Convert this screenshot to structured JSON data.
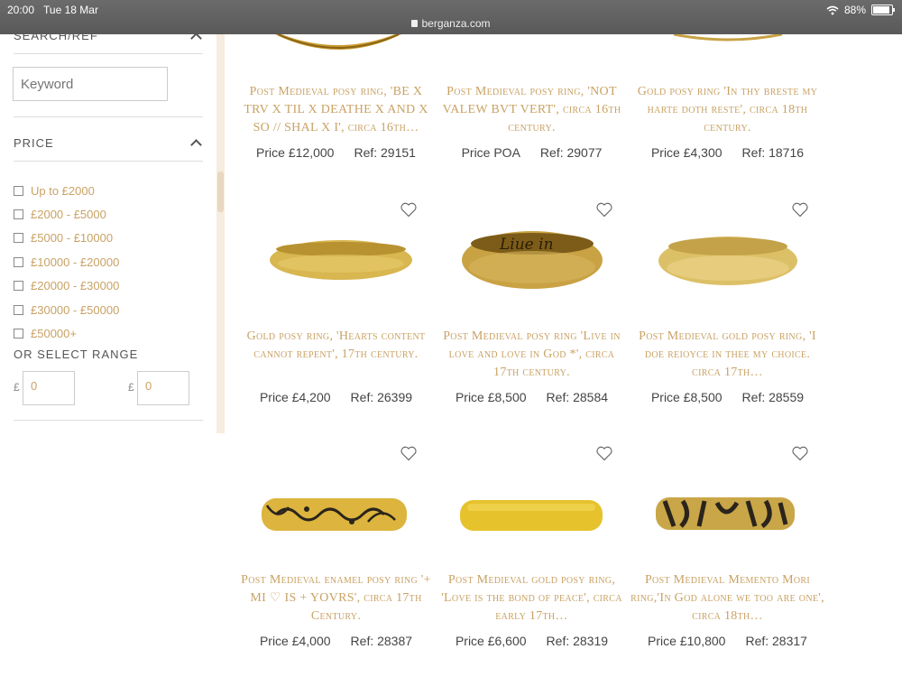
{
  "status": {
    "time": "20:00",
    "date": "Tue 18 Mar",
    "url": "berganza.com",
    "battery": "88%",
    "battery_level": 0.88
  },
  "sidebar": {
    "search_heading": "SEARCH/REF",
    "keyword_placeholder": "Keyword",
    "price_heading": "PRICE",
    "price_options": [
      "Up to £2000",
      "£2000 - £5000",
      "£5000 - £10000",
      "£10000 - £20000",
      "£20000 - £30000",
      "£30000 - £50000",
      "£50000+"
    ],
    "range_label": "OR SELECT RANGE",
    "currency": "£",
    "range_min": "0",
    "range_max": "0"
  },
  "products": [
    {
      "title": "Post Medieval posy ring, 'BE X TRV X TIL X DEATHE X AND X SO // SHAL X I', circa 16th…",
      "price": "Price £12,000",
      "ref": "Ref: 29151"
    },
    {
      "title": "Post Medieval posy ring, 'NOT VALEW BVT VERT', circa 16th century.",
      "price": "Price POA",
      "ref": "Ref: 29077"
    },
    {
      "title": "Gold posy ring 'In thy breste my harte doth reste', circa 18th century.",
      "price": "Price £4,300",
      "ref": "Ref: 18716"
    },
    {
      "title": "Gold posy ring, 'Hearts content cannot repent', 17th century.",
      "price": "Price £4,200",
      "ref": "Ref: 26399"
    },
    {
      "title": "Post Medieval posy ring 'Live in love and love in God *', circa 17th century.",
      "price": "Price £8,500",
      "ref": "Ref: 28584"
    },
    {
      "title": "Post Medieval gold posy ring, 'I doe reioyce in thee my choice. circa 17th…",
      "price": "Price £8,500",
      "ref": "Ref: 28559"
    },
    {
      "title": "Post Medieval enamel posy ring '+ MI ♡ IS + YOVRS', circa 17th Century.",
      "price": "Price £4,000",
      "ref": "Ref: 28387"
    },
    {
      "title": "Post Medieval gold posy ring, 'Love is the bond of peace', circa early 17th…",
      "price": "Price £6,600",
      "ref": "Ref: 28319"
    },
    {
      "title": "Post Medieval Memento Mori ring,'In God alone we too are one', circa 18th…",
      "price": "Price £10,800",
      "ref": "Ref: 28317"
    }
  ],
  "colors": {
    "accent": "#c9a264",
    "gold": "#d9b13b",
    "enamel": "#2a241c"
  },
  "icons": {
    "favorite": "heart-outline-icon",
    "collapse": "chevron-up-icon",
    "secure": "lock-icon"
  }
}
